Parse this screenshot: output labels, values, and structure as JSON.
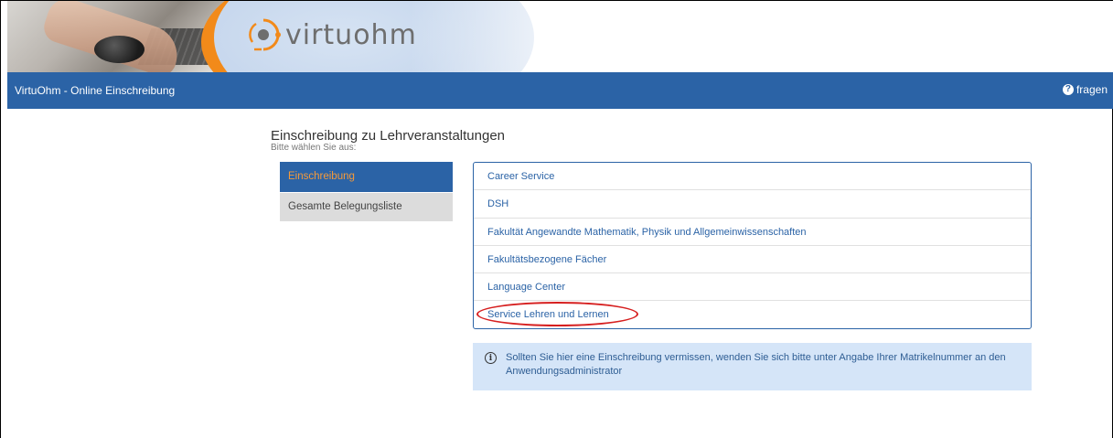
{
  "brand": {
    "logo_text": "virtuohm"
  },
  "navbar": {
    "title": "VirtuOhm - Online Einschreibung",
    "help_label": "fragen"
  },
  "page": {
    "title": "Einschreibung zu Lehrveranstaltungen",
    "subtitle": "Bitte wählen Sie aus:"
  },
  "sidebar": {
    "items": [
      {
        "label": "Einschreibung",
        "active": true
      },
      {
        "label": "Gesamte Belegungsliste",
        "active": false
      }
    ]
  },
  "faculty_list": {
    "items": [
      {
        "label": "Career Service"
      },
      {
        "label": "DSH"
      },
      {
        "label": "Fakultät Angewandte Mathematik, Physik und Allgemeinwissenschaften"
      },
      {
        "label": "Fakultätsbezogene Fächer"
      },
      {
        "label": "Language Center"
      },
      {
        "label": "Service Lehren und Lernen"
      }
    ]
  },
  "info": {
    "text": "Sollten Sie hier eine Einschreibung vermissen, wenden Sie sich bitte unter Angabe Ihrer Matrikelnummer an den Anwendungsadministrator"
  },
  "colors": {
    "primary": "#2b63a6",
    "active_text": "#f59a3a",
    "info_bg": "#d5e5f8",
    "highlight": "#d61f1f"
  }
}
